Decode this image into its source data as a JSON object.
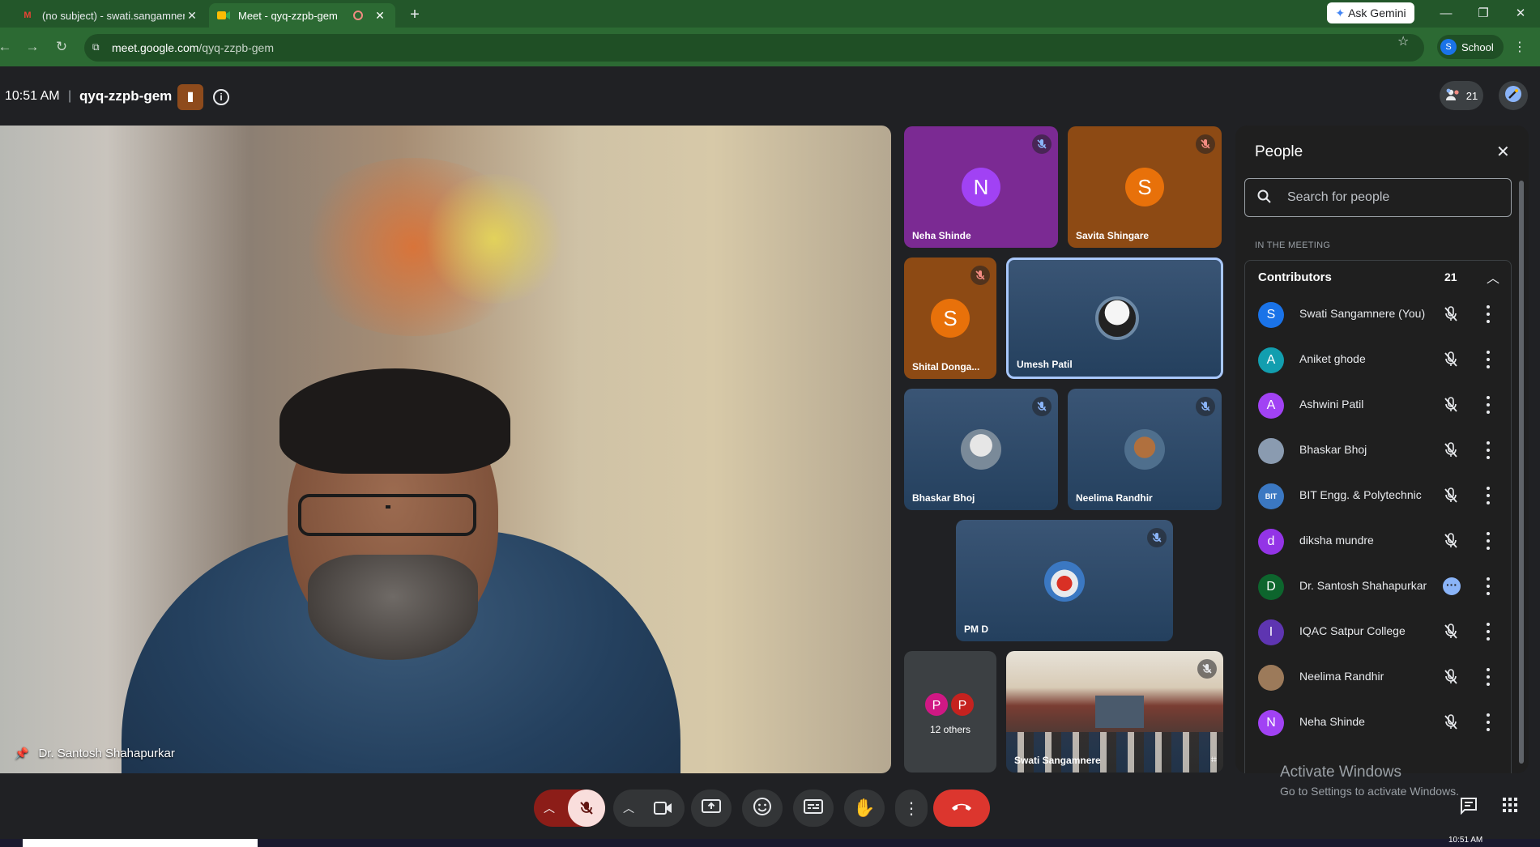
{
  "browser": {
    "tabs": [
      {
        "title": "(no subject) - swati.sangamnere",
        "icon": "gmail-icon"
      },
      {
        "title": "Meet - qyq-zzpb-gem",
        "icon": "meet-icon"
      }
    ],
    "ask_gemini": "Ask Gemini",
    "url_host": "meet.google.com",
    "url_path": "/qyq-zzpb-gem",
    "profile_initial": "S",
    "profile_label": "School"
  },
  "meeting": {
    "time": "10:51 AM",
    "separator": "|",
    "code": "qyq-zzpb-gem",
    "participant_count": "21"
  },
  "main_speaker": {
    "name": "Dr. Santosh Shahapurkar"
  },
  "tiles": [
    {
      "name": "Neha Shinde",
      "initial": "N",
      "color": "#a142f4",
      "bg": "#7b2a93"
    },
    {
      "name": "Savita Shingare",
      "initial": "S",
      "color": "#e8710a",
      "bg": "#8d4a14"
    },
    {
      "name": "Shital Donga...",
      "initial": "S",
      "color": "#e8710a",
      "bg": "#8d4a14"
    },
    {
      "name": "Umesh Patil"
    },
    {
      "name": "Bhaskar Bhoj"
    },
    {
      "name": "Neelima Randhir"
    },
    {
      "name": "PM D"
    },
    {
      "name": "12 others",
      "initials": [
        "P",
        "P"
      ]
    },
    {
      "name": "Swati Sangamnere"
    }
  ],
  "people_panel": {
    "title": "People",
    "search_placeholder": "Search for people",
    "section": "IN THE MEETING",
    "group": {
      "name": "Contributors",
      "count": "21"
    },
    "people": [
      {
        "name": "Swati Sangamnere (You)",
        "initial": "S",
        "color": "#1a73e8"
      },
      {
        "name": "Aniket ghode",
        "initial": "A",
        "color": "#129eaf"
      },
      {
        "name": "Ashwini Patil",
        "initial": "A",
        "color": "#a142f4"
      },
      {
        "name": "Bhaskar Bhoj",
        "initial": "",
        "color": "#8a9bb0"
      },
      {
        "name": "BIT Engg. & Polytechnic",
        "initial": "BIT",
        "color": "#3b78c2"
      },
      {
        "name": "diksha mundre",
        "initial": "d",
        "color": "#9334e6"
      },
      {
        "name": "Dr. Santosh Shahapurkar",
        "initial": "D",
        "color": "#0d652d"
      },
      {
        "name": "IQAC Satpur College",
        "initial": "I",
        "color": "#5e35b1"
      },
      {
        "name": "Neelima Randhir",
        "initial": "",
        "color": "#9c7a5a"
      },
      {
        "name": "Neha Shinde",
        "initial": "N",
        "color": "#a142f4"
      }
    ]
  },
  "watermark": {
    "line1": "Activate Windows",
    "line2": "Go to Settings to activate Windows."
  },
  "taskbar": {
    "time": "10:51 AM"
  }
}
